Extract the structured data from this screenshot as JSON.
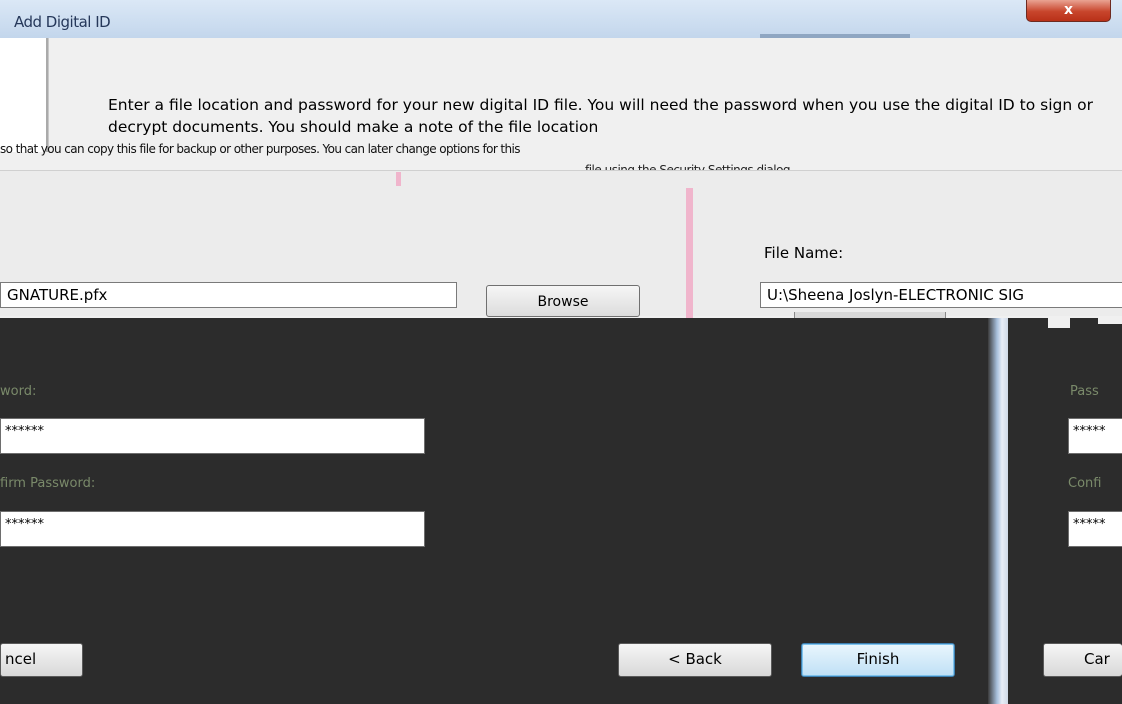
{
  "window": {
    "title": "Add Digital ID",
    "close_label": "x"
  },
  "instructions": {
    "text": "Enter a file location and password for your new digital ID file. You will need the password when you use the digital ID to sign or decrypt documents. You should make a note of the file location",
    "line3": "so that you can copy this file for backup or other purposes. You can later change options for this",
    "line4": "file using the Security Settings dialog"
  },
  "file": {
    "label": "File Name:",
    "path_left": "GNATURE.pfx",
    "path_right": "U:\\Sheena Joslyn-ELECTRONIC SIG",
    "browse_label": "Browse"
  },
  "password_left": {
    "password_label": "word:",
    "password_value": "******",
    "confirm_label": "firm Password:",
    "confirm_value": "******"
  },
  "password_right": {
    "password_label": "Pass",
    "password_value": "*****",
    "confirm_label": "Confi",
    "confirm_value": "*****"
  },
  "buttons": {
    "cancel_left": "ncel",
    "back": "< Back",
    "finish": "Finish",
    "cancel_right": "Car"
  }
}
